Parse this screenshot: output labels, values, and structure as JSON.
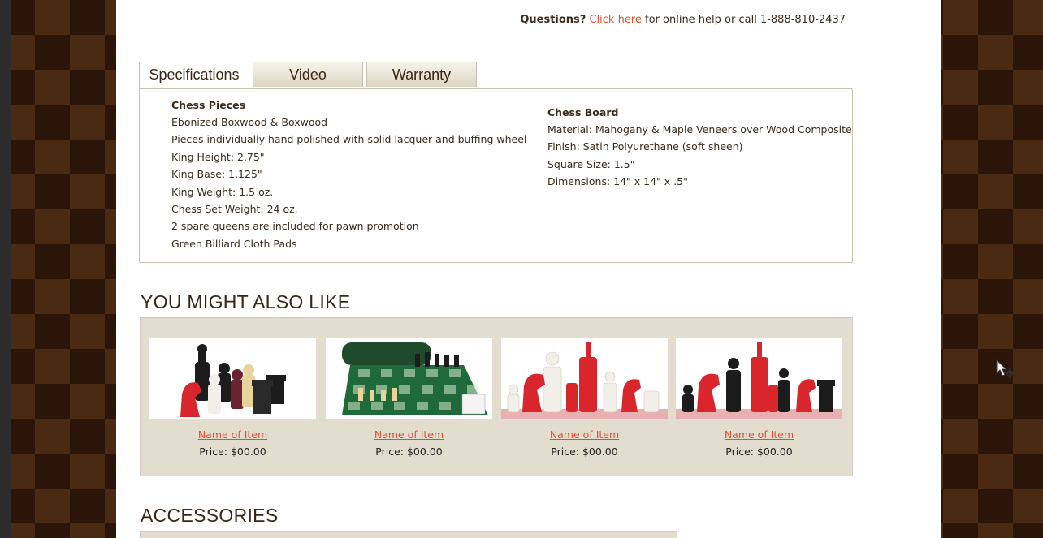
{
  "help": {
    "questions_label": "Questions?",
    "link_text": "Click here",
    "rest_text": "for online help or call 1-888-810-2437"
  },
  "tabs": [
    {
      "label": "Specifications",
      "active": true
    },
    {
      "label": "Video",
      "active": false
    },
    {
      "label": "Warranty",
      "active": false
    }
  ],
  "specs": {
    "pieces": {
      "heading": "Chess Pieces",
      "lines": [
        "Ebonized Boxwood & Boxwood",
        "Pieces individually hand polished with solid lacquer and buffing wheel",
        "King Height: 2.75\"",
        "King Base: 1.125\"",
        "King Weight: 1.5 oz.",
        "Chess Set Weight: 24 oz.",
        "2 spare queens are included for pawn promotion",
        "Green Billiard Cloth Pads"
      ]
    },
    "board": {
      "heading": "Chess Board",
      "lines": [
        "Material: Mahogany & Maple Veneers over Wood Composite",
        "Finish: Satin Polyurethane (soft sheen)",
        "Square Size: 1.5\"",
        "Dimensions: 14\" x 14\" x .5\""
      ]
    }
  },
  "also_like": {
    "title": "YOU MIGHT ALSO LIKE",
    "items": [
      {
        "name": "Name of Item",
        "price": "Price: $00.00",
        "image_icon": "chess-pieces-image"
      },
      {
        "name": "Name of Item",
        "price": "Price: $00.00",
        "image_icon": "chess-board-bag-image"
      },
      {
        "name": "Name of Item",
        "price": "Price: $00.00",
        "image_icon": "red-white-chess-pieces-image"
      },
      {
        "name": "Name of Item",
        "price": "Price: $00.00",
        "image_icon": "red-black-chess-pieces-image"
      }
    ]
  },
  "accessories": {
    "title": "ACCESSORIES"
  },
  "colors": {
    "link": "#e0502a",
    "text": "#3b2a1a",
    "panel": "#e3ddd0",
    "piece_red": "#d9262c",
    "piece_black": "#1c1c1c",
    "piece_white": "#f2efe8",
    "board_green": "#1f6a3a"
  }
}
